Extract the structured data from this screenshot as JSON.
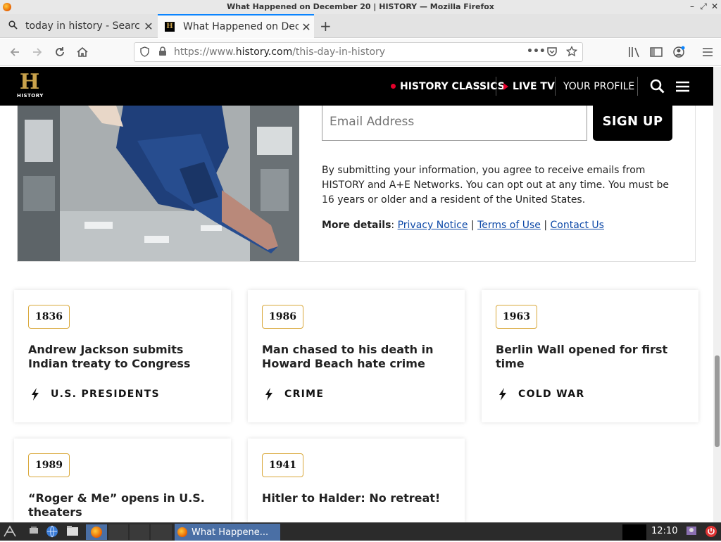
{
  "window": {
    "title": "What Happened on December 20 | HISTORY — Mozilla Firefox",
    "controls": [
      "–",
      "⤢",
      "✕"
    ]
  },
  "tabs": [
    {
      "label": "today in history - Search",
      "active": false,
      "icon": "search-icon"
    },
    {
      "label": "What Happened on Dece",
      "active": true,
      "icon": "history-favicon"
    }
  ],
  "nav": {
    "url_prefix": "https://www.",
    "url_domain": "history.com",
    "url_path": "/this-day-in-history"
  },
  "site_header": {
    "logo_letter": "H",
    "logo_word": "HISTORY",
    "history_classics": "HISTORY CLASSICS",
    "live_tv": "LIVE TV",
    "your_profile": "YOUR PROFILE",
    "accent": "#e4002b"
  },
  "newsletter": {
    "email_placeholder": "Email Address",
    "signup_label": "SIGN UP",
    "legal": "By submitting your information, you agree to receive emails from HISTORY and A+E Networks. You can opt out at any time. You must be 16 years or older and a resident of the United States.",
    "more_details_label": "More details",
    "colon": ":",
    "privacy": "Privacy Notice",
    "terms": "Terms of Use",
    "contact": "Contact Us",
    "pipe": "|"
  },
  "cards": [
    {
      "year": "1836",
      "title": "Andrew Jackson submits Indian treaty to Congress",
      "category": "U.S. PRESIDENTS"
    },
    {
      "year": "1986",
      "title": "Man chased to his death in Howard Beach hate crime",
      "category": "CRIME"
    },
    {
      "year": "1963",
      "title": "Berlin Wall opened for first time",
      "category": "COLD WAR"
    },
    {
      "year": "1989",
      "title": "“Roger & Me” opens in U.S. theaters",
      "category": ""
    },
    {
      "year": "1941",
      "title": "Hitler to Halder: No retreat!",
      "category": ""
    }
  ],
  "taskbar": {
    "task_label": "What Happene...",
    "clock": "12:10"
  },
  "colors": {
    "year_border": "#d9a83a",
    "link": "#0f4aa8",
    "tab_accent": "#0a84ff"
  }
}
